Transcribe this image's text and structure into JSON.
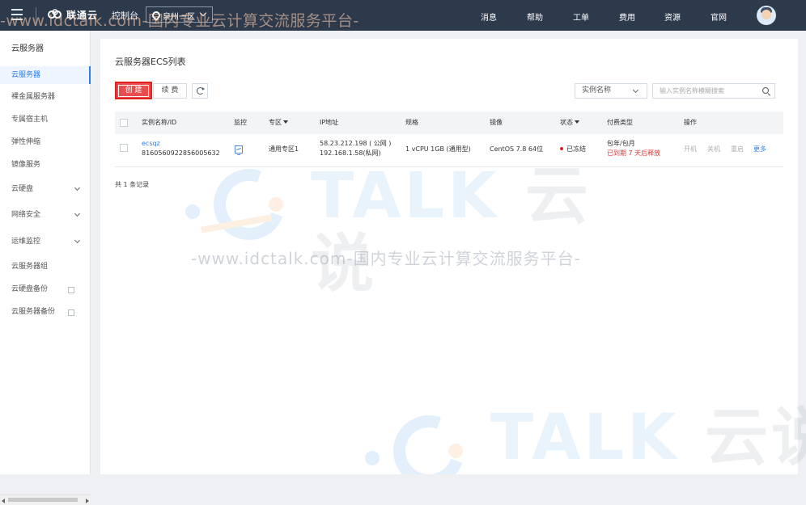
{
  "topbar": {
    "brand": "联通云",
    "console": "控制台",
    "region": "泉州一区",
    "nav": [
      "消息",
      "帮助",
      "工单",
      "费用",
      "资源",
      "官网"
    ]
  },
  "sidebar": {
    "title": "云服务器",
    "items": [
      {
        "label": "云服务器",
        "active": true
      },
      {
        "label": "裸金属服务器"
      },
      {
        "label": "专属宿主机"
      },
      {
        "label": "弹性伸缩"
      },
      {
        "label": "镜像服务"
      },
      {
        "label": "云硬盘",
        "expandable": true
      },
      {
        "label": "网络安全",
        "expandable": true
      },
      {
        "label": "运维监控",
        "expandable": true
      },
      {
        "label": "云服务器组"
      },
      {
        "label": "云硬盘备份",
        "external": true
      },
      {
        "label": "云服务器备份",
        "external": true
      }
    ]
  },
  "main": {
    "title": "云服务器ECS列表",
    "buttons": {
      "create": "创 建",
      "renew": "续 费"
    },
    "filter": {
      "selected": "实例名称",
      "placeholder": "输入实例名称模糊搜索"
    },
    "table": {
      "headers": [
        "实例名称/ID",
        "监控",
        "专区",
        "IP地址",
        "规格",
        "镜像",
        "状态",
        "付费类型",
        "操作"
      ],
      "rows": [
        {
          "name": "ecsqz",
          "id": "8160560922856005632",
          "zone": "通用专区1",
          "ip_public": "58.23.212.198 ( 公网 )",
          "ip_private": "192.168.1.58(私网)",
          "spec": "1 vCPU 1GB (通用型)",
          "image": "CentOS 7.8 64位",
          "status": "已冻结",
          "billing": "包年/包月",
          "billing_note": "已到期 7 天后释放",
          "actions": [
            "开机",
            "关机",
            "重启",
            "更多"
          ]
        }
      ]
    },
    "records": "共 1 条记录"
  },
  "watermark": {
    "top_strip": "-www.idctalk.com-国内专业云计算交流服务平台-",
    "big_latin": "TALK",
    "big_cn": "云说",
    "slogan": "-www.idctalk.com-国内专业云计算交流服务平台-"
  },
  "colors": {
    "topbar": "#2d3a4b",
    "accent": "#2f7de1",
    "danger": "#e94d4d",
    "page_bg": "#eef0f3"
  }
}
